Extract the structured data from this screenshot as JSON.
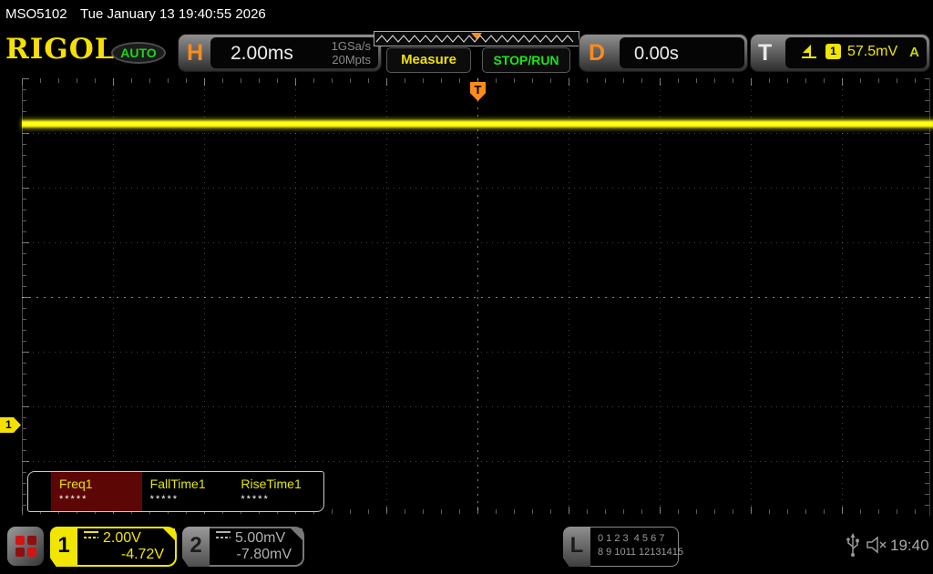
{
  "statusbar": {
    "model": "MSO5102",
    "datetime": "Tue January 13 19:40:55 2026"
  },
  "header": {
    "logo": "RIGOL",
    "mode_badge": "AUTO",
    "horizontal": {
      "label": "H",
      "timebase": "2.00ms",
      "sample_rate": "1GSa/s",
      "memory_depth": "20Mpts"
    },
    "measure_button": "Measure",
    "run_button": "STOP/RUN",
    "delay": {
      "label": "D",
      "value": "0.00s"
    },
    "trigger": {
      "label": "T",
      "source_channel": "1",
      "level": "57.5mV",
      "sweep_mode": "A"
    }
  },
  "plot": {
    "trigger_position_marker": "T",
    "channel1_marker": "1",
    "trace": {
      "channel": 1,
      "description": "flat noisy yellow band near top of graticule",
      "grid": "10x8 divisions dotted"
    }
  },
  "measurements": {
    "items": [
      {
        "name": "Freq1",
        "value": "*****",
        "selected": true
      },
      {
        "name": "FallTime1",
        "value": "*****",
        "selected": false
      },
      {
        "name": "RiseTime1",
        "value": "*****",
        "selected": false
      }
    ]
  },
  "bottombar": {
    "ch1": {
      "number": "1",
      "scale": "2.00V",
      "offset": "-4.72V"
    },
    "ch2": {
      "number": "2",
      "scale": "5.00mV",
      "offset": "-7.80mV"
    },
    "digital": {
      "label": "L",
      "row1": "0 1 2 3  4 5 6 7",
      "row2": "8 9 1011 12131415"
    },
    "clock": "19:40"
  },
  "icons": {
    "menu_grid_icon": "2x2 red squares",
    "dc_coupling_icon": "solid line over dashed line",
    "trigger_edge_icon": "rising edge with arrow",
    "memory_bar": "white zigzag with orange position triangle",
    "usb_icon": "usb trident",
    "speaker_muted_icon": "speaker with x"
  },
  "colors": {
    "trace_yellow": "#ffff12",
    "channel1_yellow": "#f0e600",
    "channel2_gray": "#9a9a9a",
    "trigger_orange": "#ff8c1a",
    "run_green": "#19e619",
    "auto_green": "#1ed41e",
    "selected_measure_red": "#5c0606",
    "logo_yellow": "#f5e003"
  }
}
